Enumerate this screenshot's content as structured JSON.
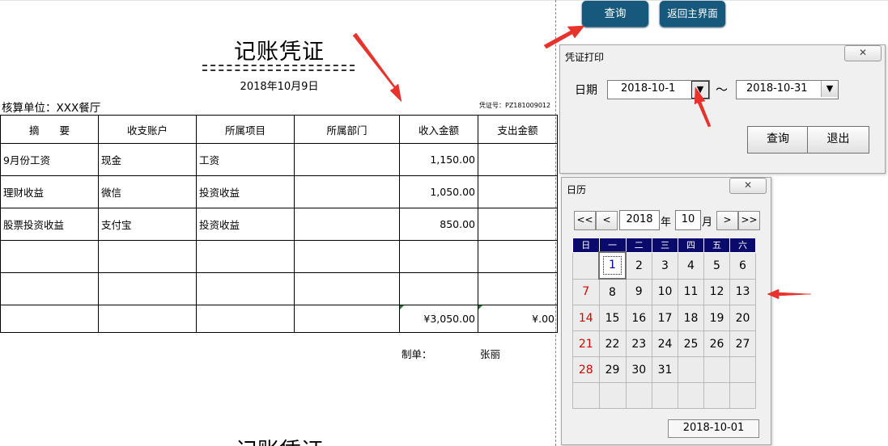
{
  "voucher": {
    "title": "记账凭证",
    "date": "2018年10月9日",
    "unit": "核算单位：XXX餐厅",
    "voucher_no": "凭证号：PZ181009012",
    "headers": [
      "摘　　要",
      "收支账户",
      "所属项目",
      "所属部门",
      "收入金额",
      "支出金额"
    ],
    "rows": [
      [
        "9月份工资",
        "现金",
        "工资",
        "",
        "1,150.00",
        ""
      ],
      [
        "理财收益",
        "微信",
        "投资收益",
        "",
        "1,050.00",
        ""
      ],
      [
        "股票投资收益",
        "支付宝",
        "投资收益",
        "",
        "850.00",
        ""
      ],
      [
        "",
        "",
        "",
        "",
        "",
        ""
      ],
      [
        "",
        "",
        "",
        "",
        "",
        ""
      ],
      [
        "",
        "",
        "",
        "",
        "¥3,050.00",
        "¥.00"
      ]
    ],
    "maker_label": "制单：",
    "maker_name": "张丽",
    "next_title": "记账凭证"
  },
  "buttons": {
    "query": "查询",
    "back_main": "返回主界面"
  },
  "print_dialog": {
    "title": "凭证打印",
    "close": "✕",
    "date_label": "日期",
    "start_date": "2018-10-1",
    "separator": "～",
    "end_date": "2018-10-31",
    "dropdown_glyph": "▼",
    "query": "查询",
    "exit": "退出"
  },
  "calendar": {
    "title": "日历",
    "close": "✕",
    "nav": {
      "prev_year": "<<",
      "prev_month": "<",
      "next_month": ">",
      "next_year": ">>"
    },
    "year": "2018",
    "year_label": "年",
    "month": "10",
    "month_label": "月",
    "weekdays": [
      "日",
      "一",
      "二",
      "三",
      "四",
      "五",
      "六"
    ],
    "weeks": [
      [
        "",
        "1",
        "2",
        "3",
        "4",
        "5",
        "6"
      ],
      [
        "7",
        "8",
        "9",
        "10",
        "11",
        "12",
        "13"
      ],
      [
        "14",
        "15",
        "16",
        "17",
        "18",
        "19",
        "20"
      ],
      [
        "21",
        "22",
        "23",
        "24",
        "25",
        "26",
        "27"
      ],
      [
        "28",
        "29",
        "30",
        "31",
        "",
        "",
        ""
      ],
      [
        "",
        "",
        "",
        "",
        "",
        "",
        ""
      ]
    ],
    "selected_day": "1",
    "footer_date": "2018-10-01"
  },
  "colors": {
    "button_blue": "#16597d",
    "weekday_header": "#0a0a6c",
    "sunday_red": "#d40000",
    "arrow_red": "#e8322c"
  }
}
